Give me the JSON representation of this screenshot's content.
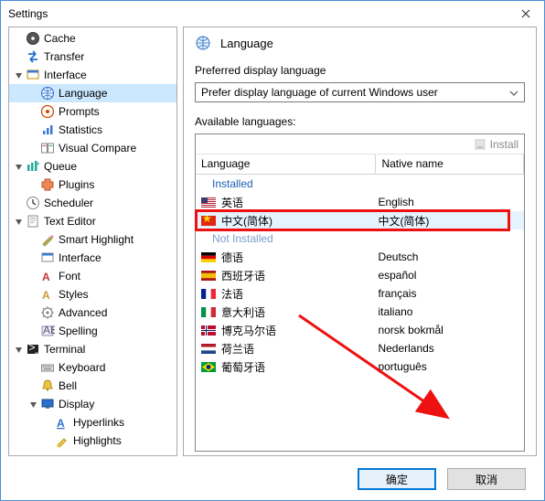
{
  "window": {
    "title": "Settings"
  },
  "sidebar": {
    "items": [
      {
        "label": "Cache",
        "icon": "disc"
      },
      {
        "label": "Transfer",
        "icon": "transfer"
      },
      {
        "label": "Interface",
        "icon": "interface",
        "expanded": true,
        "top": true
      },
      {
        "label": "Language",
        "icon": "globe",
        "indent": 1,
        "selected": true
      },
      {
        "label": "Prompts",
        "icon": "prompts",
        "indent": 1
      },
      {
        "label": "Statistics",
        "icon": "stats",
        "indent": 1
      },
      {
        "label": "Visual Compare",
        "icon": "compare",
        "indent": 1
      },
      {
        "label": "Queue",
        "icon": "queue",
        "expanded": true,
        "top": true
      },
      {
        "label": "Plugins",
        "icon": "plugins",
        "indent": 1
      },
      {
        "label": "Scheduler",
        "icon": "scheduler"
      },
      {
        "label": "Text Editor",
        "icon": "texteditor",
        "expanded": true,
        "top": true
      },
      {
        "label": "Smart Highlight",
        "icon": "smart",
        "indent": 1
      },
      {
        "label": "Interface",
        "icon": "interface2",
        "indent": 1
      },
      {
        "label": "Font",
        "icon": "font",
        "indent": 1
      },
      {
        "label": "Styles",
        "icon": "styles",
        "indent": 1
      },
      {
        "label": "Advanced",
        "icon": "advanced",
        "indent": 1
      },
      {
        "label": "Spelling",
        "icon": "spelling",
        "indent": 1
      },
      {
        "label": "Terminal",
        "icon": "terminal",
        "expanded": true,
        "top": true
      },
      {
        "label": "Keyboard",
        "icon": "keyboard",
        "indent": 1
      },
      {
        "label": "Bell",
        "icon": "bell",
        "indent": 1
      },
      {
        "label": "Display",
        "icon": "display",
        "indent": 1,
        "expanded": true,
        "top": true
      },
      {
        "label": "Hyperlinks",
        "icon": "hyperlinks",
        "indent": 2
      },
      {
        "label": "Highlights",
        "icon": "highlights",
        "indent": 2
      }
    ]
  },
  "main": {
    "heading": "Language",
    "preferred_label": "Preferred display language",
    "preferred_value": "Prefer display language of current Windows user",
    "available_label": "Available languages:",
    "install_label": "Install",
    "col_lang": "Language",
    "col_native": "Native name",
    "group_installed": "Installed",
    "group_notinstalled": "Not Installed",
    "installed": [
      {
        "name": "英语",
        "native": "English",
        "flag": "us"
      },
      {
        "name": "中文(简体)",
        "native": "中文(简体)",
        "flag": "cn",
        "selected": true,
        "highlight": true
      }
    ],
    "not_installed": [
      {
        "name": "德语",
        "native": "Deutsch",
        "flag": "de"
      },
      {
        "name": "西班牙语",
        "native": "español",
        "flag": "es"
      },
      {
        "name": "法语",
        "native": "français",
        "flag": "fr"
      },
      {
        "name": "意大利语",
        "native": "italiano",
        "flag": "it"
      },
      {
        "name": "博克马尔语",
        "native": "norsk bokmål",
        "flag": "no"
      },
      {
        "name": "荷兰语",
        "native": "Nederlands",
        "flag": "nl"
      },
      {
        "name": "葡萄牙语",
        "native": "português",
        "flag": "br"
      }
    ]
  },
  "footer": {
    "ok": "确定",
    "cancel": "取消"
  }
}
